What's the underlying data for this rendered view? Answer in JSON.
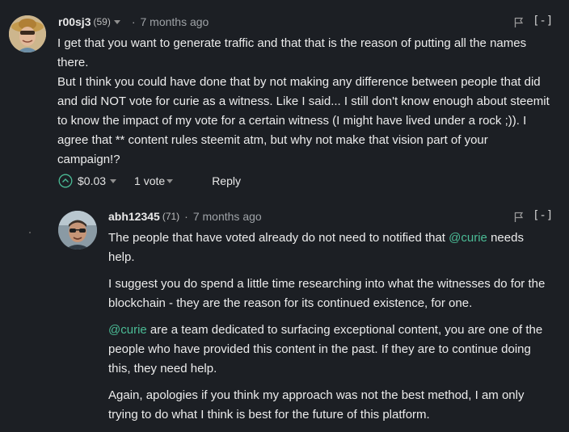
{
  "comment1": {
    "author": "r00sj3",
    "reputation": "(59)",
    "timestamp": "7 months ago",
    "collapse_label": "[-]",
    "lines": [
      "I get that you want to generate traffic and that that is the reason of putting all the names",
      "there.",
      "But I think you could have done that by not making any difference between people that did",
      "and did NOT vote for curie as a witness. Like I said... I still don't know enough about steemit",
      "to know the impact of my vote for a certain witness (I might have lived under a rock ;)). I",
      "agree that ** content rules steemit atm, but why not make that vision part of your",
      "campaign!?"
    ],
    "payout": "$0.03",
    "votes": "1 vote",
    "reply_label": "Reply"
  },
  "comment2": {
    "author": "abh12345",
    "reputation": "(71)",
    "timestamp": "7 months ago",
    "collapse_label": "[-]",
    "p1": {
      "line1_pre": "The people that have voted already do not need to notified that ",
      "line1_mention": "@curie",
      "line1_post": " needs",
      "line2": "help."
    },
    "p2": {
      "line1": "I suggest you do spend a little time researching into what the witnesses do for the",
      "line2": "blockchain - they are the reason for its continued existence, for one."
    },
    "p3": {
      "mention": "@curie",
      "line1_post": " are a team dedicated to surfacing exceptional content, you are one of the",
      "line2": "people who have provided this content in the past. If they are to continue doing",
      "line3": "this, they need help."
    },
    "p4": {
      "line1": "Again, apologies if you think my approach was not the best method, I am only",
      "line2": "trying to do what I think is best for the future of this platform."
    }
  }
}
